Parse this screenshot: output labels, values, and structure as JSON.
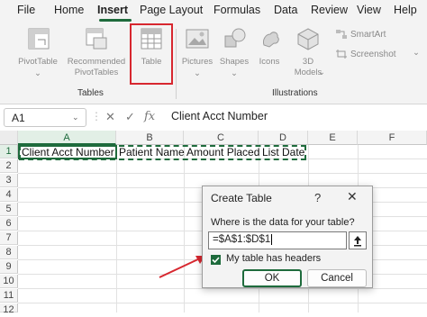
{
  "ribbon_tabs": [
    "File",
    "Home",
    "Insert",
    "Page Layout",
    "Formulas",
    "Data",
    "Review",
    "View",
    "Help"
  ],
  "active_tab": "Insert",
  "ribbon": {
    "pivottable": "PivotTable",
    "recommended_line1": "Recommended",
    "recommended_line2": "PivotTables",
    "table": "Table",
    "pictures": "Pictures",
    "shapes": "Shapes",
    "icons": "Icons",
    "models_line1": "3D",
    "models_line2": "Models",
    "smartart": "SmartArt",
    "screenshot": "Screenshot",
    "group_tables": "Tables",
    "group_illustrations": "Illustrations"
  },
  "formula_bar": {
    "name_box": "A1",
    "cancel_symbol": "✕",
    "enter_symbol": "✓",
    "fx_symbol": "fx",
    "content": "Client Acct Number"
  },
  "sheet": {
    "columns": [
      "A",
      "B",
      "C",
      "D",
      "E",
      "F"
    ],
    "rows": [
      "1",
      "2",
      "3",
      "4",
      "5",
      "6",
      "7",
      "8",
      "9",
      "10",
      "11",
      "12"
    ],
    "row1_cells": [
      "Client Acct Number",
      "Patient Name",
      "Amount Placed",
      "List Date"
    ]
  },
  "dialog": {
    "title": "Create Table",
    "help": "?",
    "close": "✕",
    "prompt": "Where is the data for your table?",
    "range": "=$A$1:$D$1",
    "checkbox_label": "My table has headers",
    "checkbox_checked": true,
    "ok_label": "OK",
    "cancel_label": "Cancel"
  },
  "colors": {
    "accent": "#1e6b3c",
    "highlight": "#d7272f"
  }
}
